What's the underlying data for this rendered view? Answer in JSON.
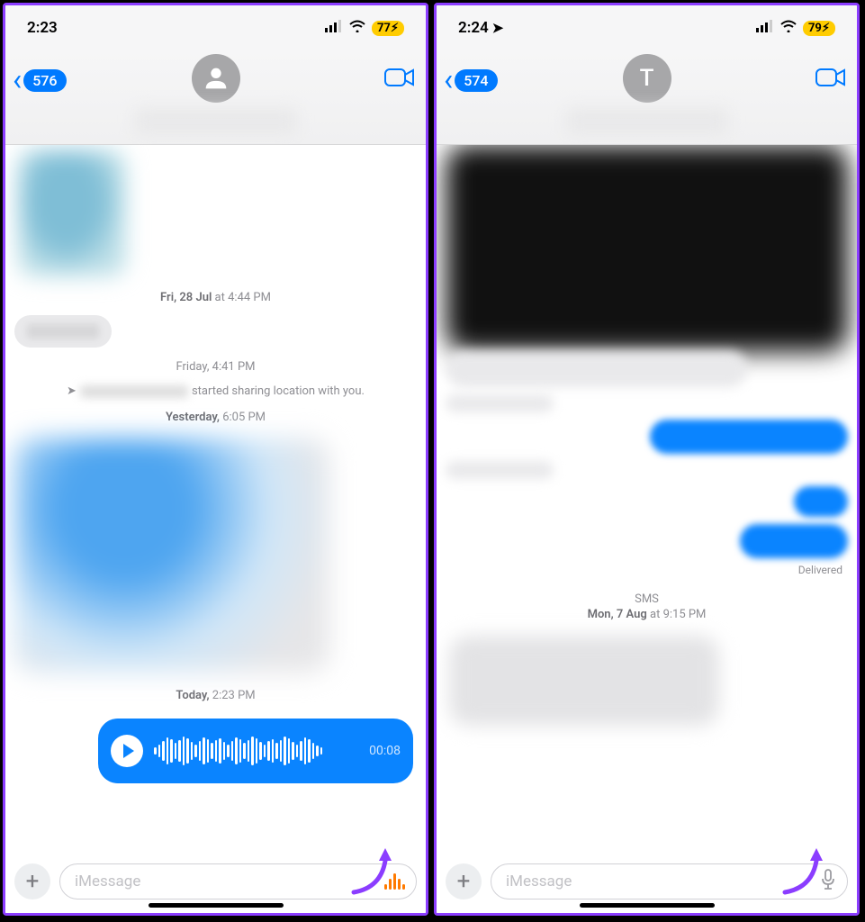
{
  "left": {
    "status": {
      "time": "2:23",
      "battery": "77"
    },
    "nav": {
      "back_count": "576"
    },
    "timestamps": {
      "t1_prefix": "Fri, 28 Jul",
      "t1_at": " at ",
      "t1_time": "4:44 PM",
      "t2": "Friday, 4:41 PM",
      "sys_suffix": " started sharing location with you.",
      "t3_prefix": "Yesterday,",
      "t3_time": " 6:05 PM",
      "t4_prefix": "Today,",
      "t4_time": " 2:23 PM"
    },
    "audio": {
      "duration": "00:08"
    },
    "input": {
      "placeholder": "iMessage"
    }
  },
  "right": {
    "status": {
      "time": "2:24",
      "battery": "79"
    },
    "nav": {
      "back_count": "574",
      "avatar_initial": "T"
    },
    "delivered": "Delivered",
    "sms_label": "SMS",
    "sms_ts_prefix": "Mon, 7 Aug",
    "sms_ts_at": " at ",
    "sms_ts_time": "9:15 PM",
    "input": {
      "placeholder": "iMessage"
    }
  }
}
